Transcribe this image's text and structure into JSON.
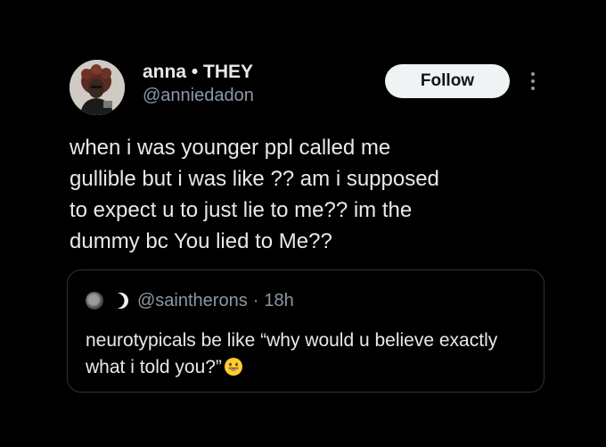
{
  "author": {
    "display_name": "anna • THEY",
    "handle": "@anniedadon",
    "avatar_icon": "profile-photo"
  },
  "actions": {
    "follow_label": "Follow",
    "more_icon": "more-vertical-icon"
  },
  "tweet": {
    "text": "when i was younger ppl called me\ngullible but i was like ?? am i supposed\nto expect u to just lie to me?? im the\ndummy bc You lied to Me??"
  },
  "quoted_tweet": {
    "handle": "@saintherons",
    "separator": "·",
    "time": "18h",
    "text": "neurotypicals be like “why would u believe exactly what i told you?”",
    "emoji_icon": "grinning-face-icon",
    "name_icon": "crescent-moon-icon"
  },
  "colors": {
    "background": "#000000",
    "primary_text": "#e7e9ea",
    "secondary_text": "#8b98a5",
    "button_bg": "#eff3f4",
    "border": "#2f3336"
  }
}
